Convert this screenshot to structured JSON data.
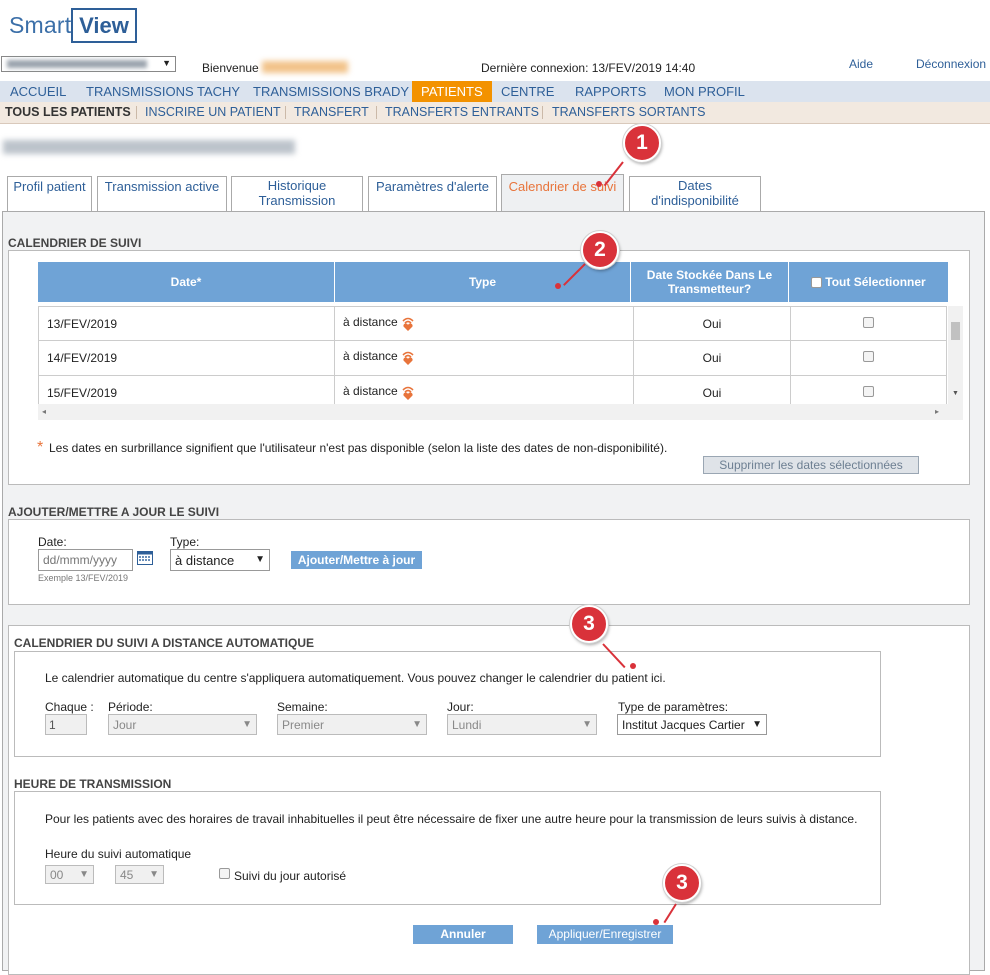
{
  "header": {
    "logo_smart": "Smart",
    "logo_view": "View",
    "welcome": "Bienvenue",
    "last_login": "Dernière connexion: 13/FEV/2019 14:40",
    "help": "Aide",
    "logout": "Déconnexion"
  },
  "main_nav": [
    "ACCUEIL",
    "TRANSMISSIONS TACHY",
    "TRANSMISSIONS BRADY",
    "PATIENTS",
    "CENTRE",
    "RAPPORTS",
    "MON PROFIL"
  ],
  "sub_nav": [
    "TOUS LES PATIENTS",
    "INSCRIRE UN PATIENT",
    "TRANSFERT",
    "TRANSFERTS ENTRANTS",
    "TRANSFERTS SORTANTS"
  ],
  "tabs": [
    "Profil patient",
    "Transmission active",
    "Historique\nTransmission",
    "Paramètres d'alerte",
    "Calendrier de suivi",
    "Dates\nd'indisponibilité"
  ],
  "calendar": {
    "section_title": "CALENDRIER DE SUIVI",
    "col_date": "Date*",
    "col_type": "Type",
    "col_stored": "Date Stockée Dans Le Transmetteur?",
    "col_select_all": "Tout Sélectionner",
    "rows": [
      {
        "date": "13/FEV/2019",
        "type": "à distance",
        "stored": "Oui"
      },
      {
        "date": "14/FEV/2019",
        "type": "à distance",
        "stored": "Oui"
      },
      {
        "date": "15/FEV/2019",
        "type": "à distance",
        "stored": "Oui"
      }
    ],
    "note_star": "*",
    "note": "Les dates en surbrillance signifient que l'utilisateur n'est pas disponible (selon la liste des dates de non-disponibilité).",
    "delete_button": "Supprimer les dates sélectionnées"
  },
  "add_update": {
    "section_title": "AJOUTER/METTRE A JOUR LE SUIVI",
    "date_label": "Date:",
    "date_placeholder": "dd/mmm/yyyy",
    "date_example": "Exemple 13/FEV/2019",
    "type_label": "Type:",
    "type_value": "à distance",
    "button": "Ajouter/Mettre à jour"
  },
  "auto_schedule": {
    "section_title": "CALENDRIER DU SUIVI A DISTANCE AUTOMATIQUE",
    "description": "Le calendrier automatique du centre s'appliquera automatiquement. Vous pouvez changer le calendrier du patient ici.",
    "every_label": "Chaque :",
    "every_value": "1",
    "period_label": "Période:",
    "period_value": "Jour",
    "week_label": "Semaine:",
    "week_value": "Premier",
    "day_label": "Jour:",
    "day_value": "Lundi",
    "param_label": "Type de paramètres:",
    "param_value": "Institut Jacques Cartier"
  },
  "transmission_time": {
    "section_title": "HEURE DE TRANSMISSION",
    "description": "Pour les patients avec des horaires de travail inhabituelles il peut être nécessaire de fixer une autre heure pour la transmission de leurs suivis à distance.",
    "auto_label": "Heure du suivi automatique",
    "hour_value": "00",
    "minute_value": "45",
    "same_day_label": "Suivi du jour autorisé"
  },
  "actions": {
    "cancel": "Annuler",
    "apply": "Appliquer/Enregistrer"
  },
  "callouts": [
    "1",
    "2",
    "3",
    "3"
  ],
  "colors": {
    "accent_orange": "#f39200",
    "header_blue": "#6fa3d6",
    "link_blue": "#2e5f98",
    "callout_red": "#d9323a",
    "active_tab_text": "#e8743b"
  }
}
